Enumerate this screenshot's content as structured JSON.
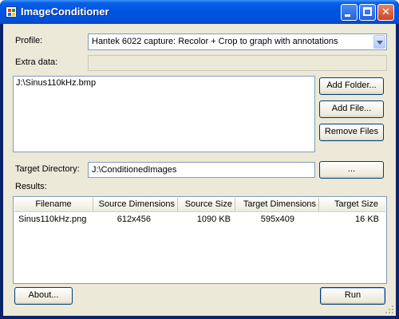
{
  "window": {
    "title": "ImageConditioner"
  },
  "profile": {
    "label": "Profile:",
    "value": "Hantek 6022 capture: Recolor + Crop to graph with annotations"
  },
  "extra_data": {
    "label": "Extra data:",
    "value": ""
  },
  "files": {
    "items": [
      "J:\\Sinus110kHz.bmp"
    ]
  },
  "buttons": {
    "add_folder": "Add Folder...",
    "add_file": "Add File...",
    "remove_files": "Remove Files",
    "browse": "...",
    "about": "About...",
    "run": "Run"
  },
  "target": {
    "label": "Target Directory:",
    "value": "J:\\ConditionedImages"
  },
  "results": {
    "label": "Results:",
    "columns": [
      "Filename",
      "Source Dimensions",
      "Source Size",
      "Target Dimensions",
      "Target Size"
    ],
    "rows": [
      [
        "Sinus110kHz.png",
        "612x456",
        "1090 KB",
        "595x409",
        "16 KB"
      ]
    ]
  },
  "icons": {
    "app": "app-icon",
    "minimize": "minimize-icon",
    "maximize": "maximize-icon",
    "close": "close-icon",
    "dropdown": "chevron-down-icon",
    "resize": "resize-grip-icon"
  }
}
